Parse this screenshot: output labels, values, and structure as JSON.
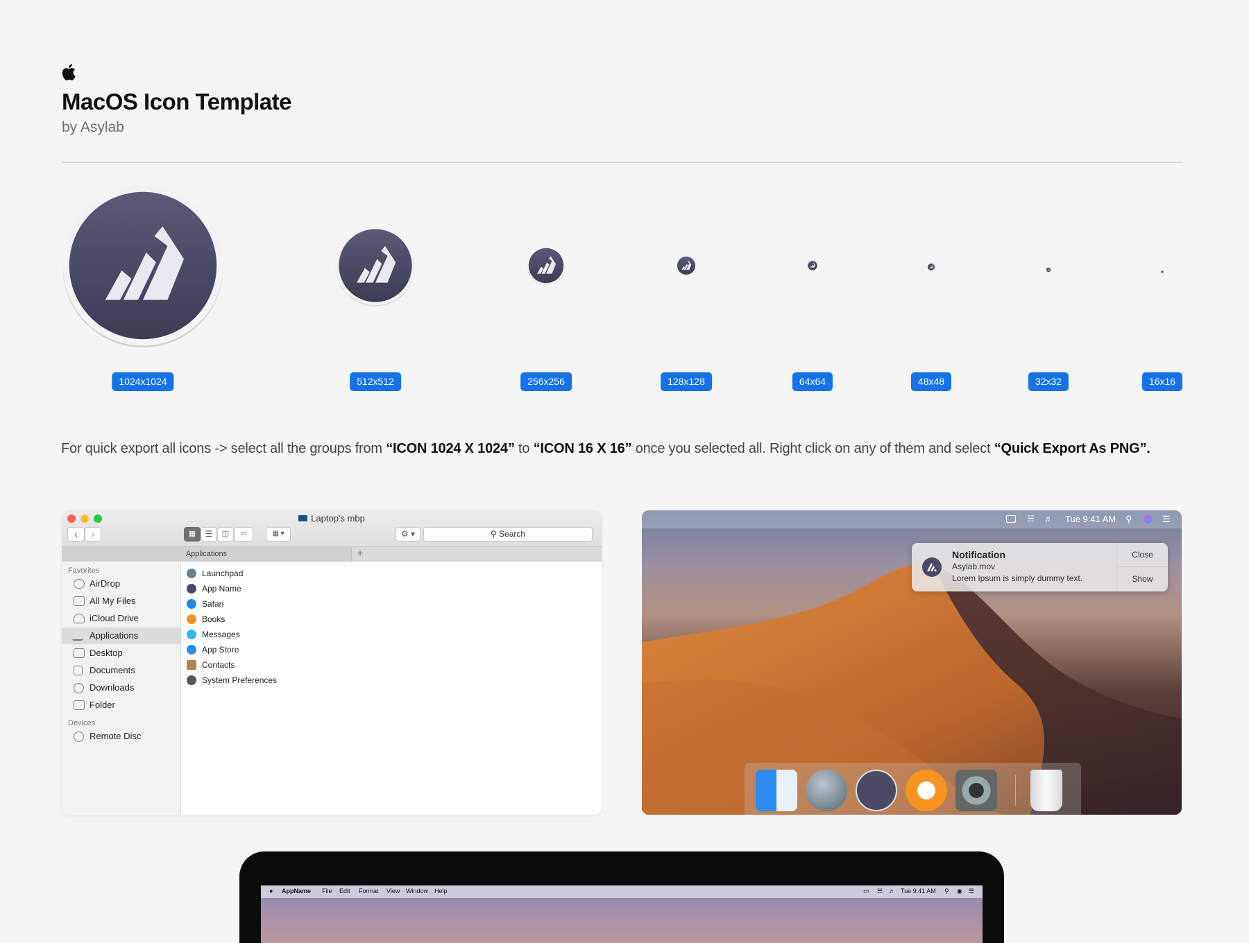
{
  "header": {
    "title": "MacOS Icon Template",
    "subtitle": "by Asylab"
  },
  "colors": {
    "accent": "#1572e8",
    "icon_base": "#4b4a66",
    "background": "#f5f5f5"
  },
  "icon_sizes": [
    "1024x1024",
    "512x512",
    "256x256",
    "128x128",
    "64x64",
    "48x48",
    "32x32",
    "16x16"
  ],
  "instructions": {
    "part1": "For quick export all icons -> select all the groups from ",
    "bold1": "“ICON 1024 X 1024”",
    "part2": " to ",
    "bold2": "“ICON 16 X 16”",
    "part3": " once you selected all. Right click on any of them and select ",
    "bold3": "“Quick Export As PNG”."
  },
  "finder": {
    "window_title": "Laptop's mbp",
    "search_placeholder": "Search",
    "tab_label": "Applications",
    "tab_add": "+",
    "sidebar": {
      "favorites_header": "Favorites",
      "favorites": [
        "AirDrop",
        "All My Files",
        "iCloud Drive",
        "Applications",
        "Desktop",
        "Documents",
        "Downloads",
        "Folder"
      ],
      "selected": "Applications",
      "devices_header": "Devices",
      "devices": [
        "Remote Disc"
      ]
    },
    "apps": [
      "Launchpad",
      "App Name",
      "Safari",
      "Books",
      "Messages",
      "App Store",
      "Contacts",
      "System Preferences"
    ]
  },
  "desktop": {
    "menubar": {
      "clock": "Tue 9:41 AM"
    },
    "notification": {
      "title": "Notification",
      "subtitle": "Asylab.mov",
      "body": "Lorem Ipsum is simply dummy text.",
      "close_label": "Close",
      "show_label": "Show"
    },
    "dock_apps": [
      "finder-icon",
      "launchpad-icon",
      "app-icon",
      "books-icon",
      "system-preferences-icon",
      "trash-icon"
    ]
  },
  "laptop": {
    "app_name": "AppName",
    "menus": [
      "File",
      "Edit",
      "Format",
      "View",
      "Window",
      "Help"
    ],
    "clock": "Tue 9:41 AM"
  }
}
